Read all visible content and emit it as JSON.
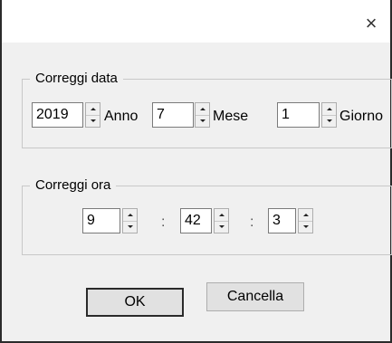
{
  "window": {
    "close_glyph": "×"
  },
  "date_group": {
    "legend": "Correggi data",
    "year": {
      "value": "2019",
      "label": "Anno"
    },
    "month": {
      "value": "7",
      "label": "Mese"
    },
    "day": {
      "value": "1",
      "label": "Giorno"
    }
  },
  "time_group": {
    "legend": "Correggi ora",
    "hour": {
      "value": "9"
    },
    "minute": {
      "value": "42"
    },
    "second": {
      "value": "3"
    },
    "separator": ":"
  },
  "buttons": {
    "ok": "OK",
    "cancel": "Cancella"
  }
}
